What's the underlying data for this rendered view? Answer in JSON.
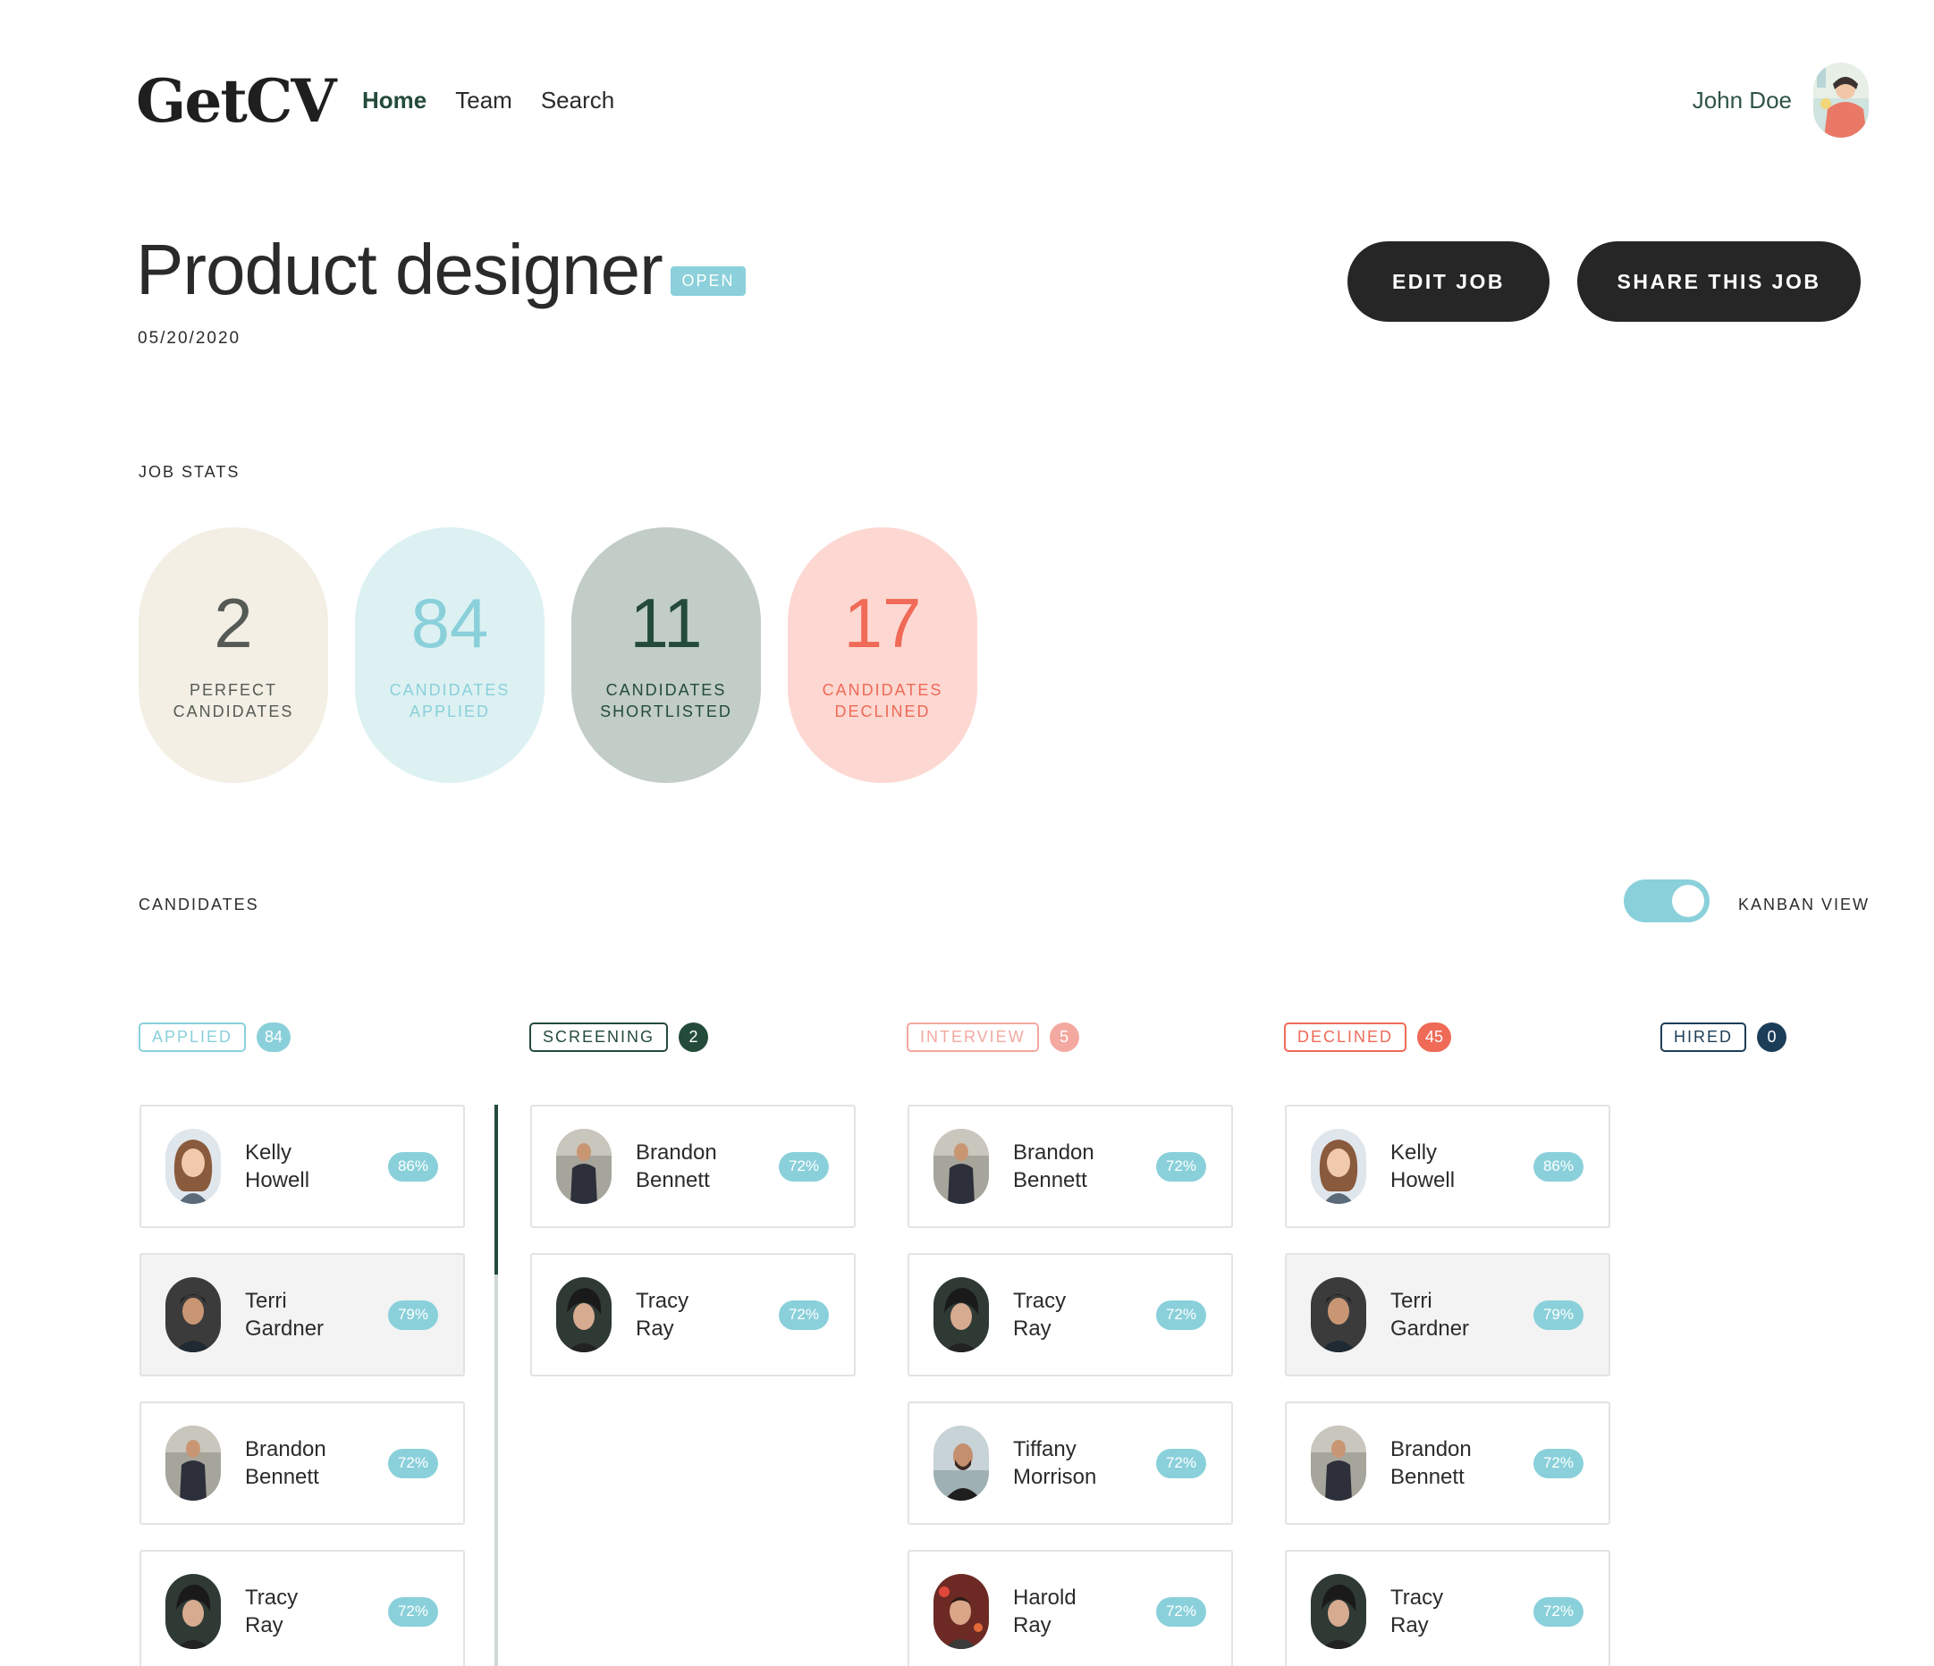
{
  "app": {
    "logo": "GetCV"
  },
  "nav": {
    "items": [
      "Home",
      "Team",
      "Search"
    ]
  },
  "user": {
    "name": "John Doe"
  },
  "job": {
    "title": "Product designer",
    "status": "OPEN",
    "date": "05/20/2020",
    "edit_label": "EDIT JOB",
    "share_label": "SHARE THIS JOB"
  },
  "stats": {
    "section_label": "JOB STATS",
    "items": [
      {
        "value": "2",
        "label": "PERFECT\nCANDIDATES"
      },
      {
        "value": "84",
        "label": "CANDIDATES\nAPPLIED"
      },
      {
        "value": "11",
        "label": "CANDIDATES\nSHORTLISTED"
      },
      {
        "value": "17",
        "label": "CANDIDATES\nDECLINED"
      }
    ]
  },
  "candidates": {
    "section_label": "CANDIDATES",
    "kanban_label": "KANBAN VIEW",
    "kanban_enabled": true,
    "columns": [
      {
        "label": "APPLIED",
        "count": "84",
        "cards": [
          {
            "first": "Kelly",
            "last": "Howell",
            "score": "86%"
          },
          {
            "first": "Terri",
            "last": "Gardner",
            "score": "79%"
          },
          {
            "first": "Brandon",
            "last": "Bennett",
            "score": "72%"
          },
          {
            "first": "Tracy",
            "last": "Ray",
            "score": "72%"
          }
        ]
      },
      {
        "label": "SCREENING",
        "count": "2",
        "cards": [
          {
            "first": "Brandon",
            "last": "Bennett",
            "score": "72%"
          },
          {
            "first": "Tracy",
            "last": "Ray",
            "score": "72%"
          }
        ]
      },
      {
        "label": "INTERVIEW",
        "count": "5",
        "cards": [
          {
            "first": "Brandon",
            "last": "Bennett",
            "score": "72%"
          },
          {
            "first": "Tracy",
            "last": "Ray",
            "score": "72%"
          },
          {
            "first": "Tiffany",
            "last": "Morrison",
            "score": "72%"
          },
          {
            "first": "Harold",
            "last": "Ray",
            "score": "72%"
          }
        ]
      },
      {
        "label": "DECLINED",
        "count": "45",
        "cards": [
          {
            "first": "Kelly",
            "last": "Howell",
            "score": "86%"
          },
          {
            "first": "Terri",
            "last": "Gardner",
            "score": "79%"
          },
          {
            "first": "Brandon",
            "last": "Bennett",
            "score": "72%"
          },
          {
            "first": "Tracy",
            "last": "Ray",
            "score": "72%"
          }
        ]
      },
      {
        "label": "HIRED",
        "count": "0",
        "cards": []
      }
    ]
  },
  "colors": {
    "accent_teal": "#8ad0da",
    "dark_green": "#244b3a",
    "coral": "#ef6a57",
    "pink": "#f3a8a0",
    "navy": "#1c3d58",
    "button_dark": "#262626"
  }
}
